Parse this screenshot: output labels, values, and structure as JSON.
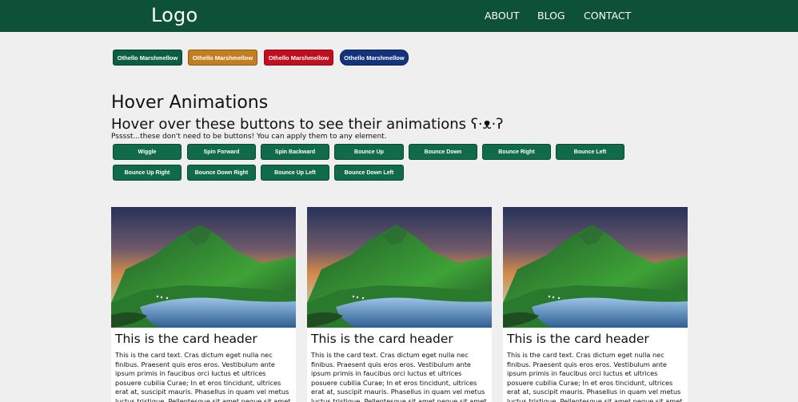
{
  "nav": {
    "logo": "Logo",
    "links": [
      "ABOUT",
      "BLOG",
      "CONTACT"
    ]
  },
  "top_buttons": [
    {
      "label": "Othello Marshmellow",
      "color": "#0c5e43"
    },
    {
      "label": "Othello Marshmellow",
      "color": "#c27e1f"
    },
    {
      "label": "Othello Marshmellow",
      "color": "#c0101f"
    },
    {
      "label": "Othello Marshmellow",
      "color": "#13337d"
    }
  ],
  "hover": {
    "title": "Hover Animations",
    "subtitle": "Hover over these buttons to see their animations ʕ·ᴥ·ʔ",
    "note": "Psssst...these don't need to be buttons! You can apply them to any element.",
    "buttons": [
      "Wiggle",
      "Spin Forward",
      "Spin Backward",
      "Bounce Up",
      "Bounce Down",
      "Bounce Right",
      "Bounce Left",
      "Bounce Up Right",
      "Bounce Down Right",
      "Bounce Up Left",
      "Bounce Down Left"
    ]
  },
  "cards": [
    {
      "header": "This is the card header",
      "text": "This is the card text. Cras dictum eget nulla nec finibus. Praesent quis eros eros. Vestibulum ante ipsum primis in faucibus orci luctus et ultrices posuere cubilia Curae; In et eros tincidunt, ultrices erat at, suscipit mauris. Phasellus in quam vel metus luctus tristique. Pellentesque sit amet neque sit amet tellus lacinia"
    },
    {
      "header": "This is the card header",
      "text": "This is the card text. Cras dictum eget nulla nec finibus. Praesent quis eros eros. Vestibulum ante ipsum primis in faucibus orci luctus et ultrices posuere cubilia Curae; In et eros tincidunt, ultrices erat at, suscipit mauris. Phasellus in quam vel metus luctus tristique. Pellentesque sit amet neque sit amet tellus lacinia"
    },
    {
      "header": "This is the card header",
      "text": "This is the card text. Cras dictum eget nulla nec finibus. Praesent quis eros eros. Vestibulum ante ipsum primis in faucibus orci luctus et ultrices posuere cubilia Curae; In et eros tincidunt, ultrices erat at, suscipit mauris. Phasellus in quam vel metus luctus tristique. Pellentesque sit amet neque sit amet tellus lacinia"
    }
  ]
}
